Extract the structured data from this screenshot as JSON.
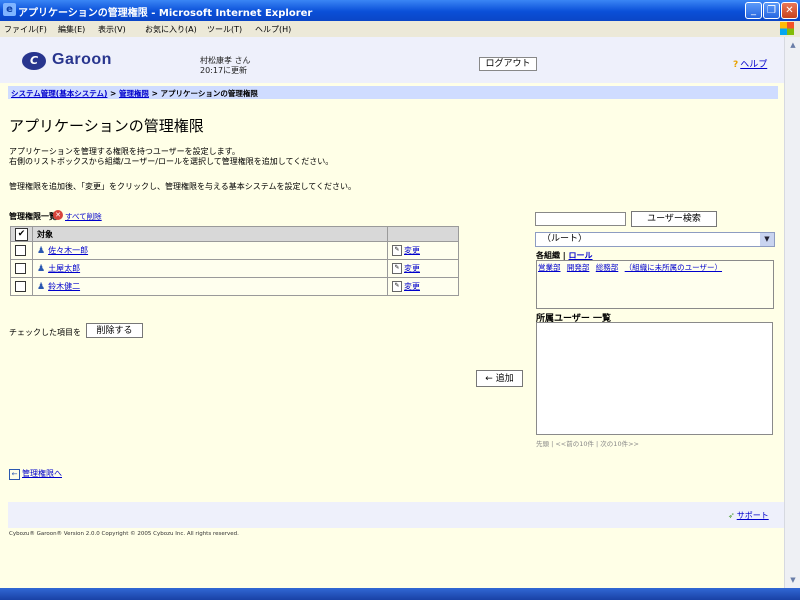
{
  "window": {
    "title": "アプリケーションの管理権限 - Microsoft Internet Explorer",
    "menu": [
      "ファイル(F)",
      "編集(E)",
      "表示(V)",
      "お気に入り(A)",
      "ツール(T)",
      "ヘルプ(H)"
    ]
  },
  "header": {
    "logo_text": "Garoon",
    "user_name": "村松康孝 さん",
    "updated": "20:17に更新",
    "logout": "ログアウト",
    "help": "ヘルプ"
  },
  "breadcrumb": {
    "items": [
      "システム管理(基本システム)",
      "管理権限",
      "アプリケーションの管理権限"
    ],
    "sep": ">"
  },
  "main": {
    "title": "アプリケーションの管理権限",
    "desc1": "アプリケーションを管理する権限を持つユーザーを設定します。",
    "desc2": "右側のリストボックスから組織/ユーザー/ロールを選択して管理権限を追加してください。",
    "desc3": "管理権限を追加後、「変更」をクリックし、管理権限を与える基本システムを設定してください。",
    "list_heading": "管理権限一覧",
    "delete_all": "すべて削除",
    "table_header": "対象",
    "rows": [
      {
        "name": "佐々木一郎",
        "action": "変更"
      },
      {
        "name": "土屋太郎",
        "action": "変更"
      },
      {
        "name": "鈴木健二",
        "action": "変更"
      }
    ],
    "checked_label": "チェックした項目を",
    "delete_button": "削除する",
    "add_button": "← 追加",
    "back_link": "管理権限へ"
  },
  "side": {
    "search_button": "ユーザー検索",
    "org_select": "（ルート）",
    "org_header_a": "各組織",
    "org_header_sep": "|",
    "org_header_b": "ロール",
    "orgs": [
      "営業部",
      "開発部",
      "総務部",
      "（組織に未所属のユーザー）"
    ],
    "members_heading": "所属ユーザー 一覧",
    "pager": "先頭 | <<前の10件 | 次の10件>>"
  },
  "footer": {
    "support": "サポート",
    "copyright": "Cybozu® Garoon® Version 2.0.0   Copyright © 2005 Cybozu Inc. All rights reserved."
  }
}
